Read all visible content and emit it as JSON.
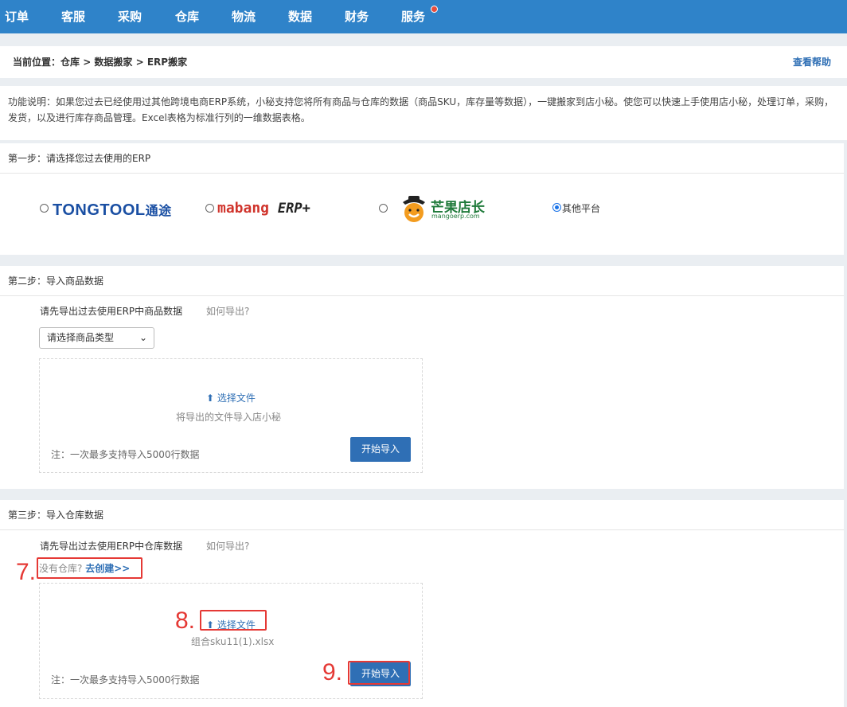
{
  "nav": {
    "items": [
      "订单",
      "客服",
      "采购",
      "仓库",
      "物流",
      "数据",
      "财务",
      "服务"
    ]
  },
  "breadcrumb": {
    "prefix": "当前位置：",
    "path": "仓库 > 数据搬家 > ERP搬家",
    "help": "查看帮助"
  },
  "description": "功能说明：如果您过去已经使用过其他跨境电商ERP系统，小秘支持您将所有商品与仓库的数据（商品SKU，库存量等数据），一键搬家到店小秘。使您可以快速上手使用店小秘，处理订单，采购，发货，以及进行库存商品管理。Excel表格为标准行列的一维数据表格。",
  "step1": {
    "title": "第一步：请选择您过去使用的ERP",
    "options": {
      "tongtool": "TONGTOOL",
      "tongtool_cn": "通途",
      "mabang": "mabang",
      "mabang_erp": "ERP+",
      "mango": "芒果店长",
      "mango_sub": "mangoerp.com",
      "other": "其他平台"
    },
    "selected": "其他平台"
  },
  "step2": {
    "title": "第二步：导入商品数据",
    "instruction": "请先导出过去使用ERP中商品数据",
    "how": "如何导出?",
    "select_value": "请选择商品类型",
    "pick_file": "选择文件",
    "hint": "将导出的文件导入店小秘",
    "note": "注：一次最多支持导入5000行数据",
    "import_btn": "开始导入"
  },
  "step3": {
    "title": "第三步：导入仓库数据",
    "instruction": "请先导出过去使用ERP中仓库数据",
    "how": "如何导出?",
    "no_warehouse": "没有仓库?",
    "create": "去创建>>",
    "pick_file": "选择文件",
    "file_name": "组合sku11(1).xlsx",
    "note": "注：一次最多支持导入5000行数据",
    "import_btn": "开始导入"
  },
  "annotations": [
    "7.",
    "8.",
    "9."
  ],
  "colors": {
    "nav_bg": "#2f83c9",
    "primary": "#2f6fb5",
    "annotation": "#e53935",
    "badge": "#e74c3c"
  }
}
